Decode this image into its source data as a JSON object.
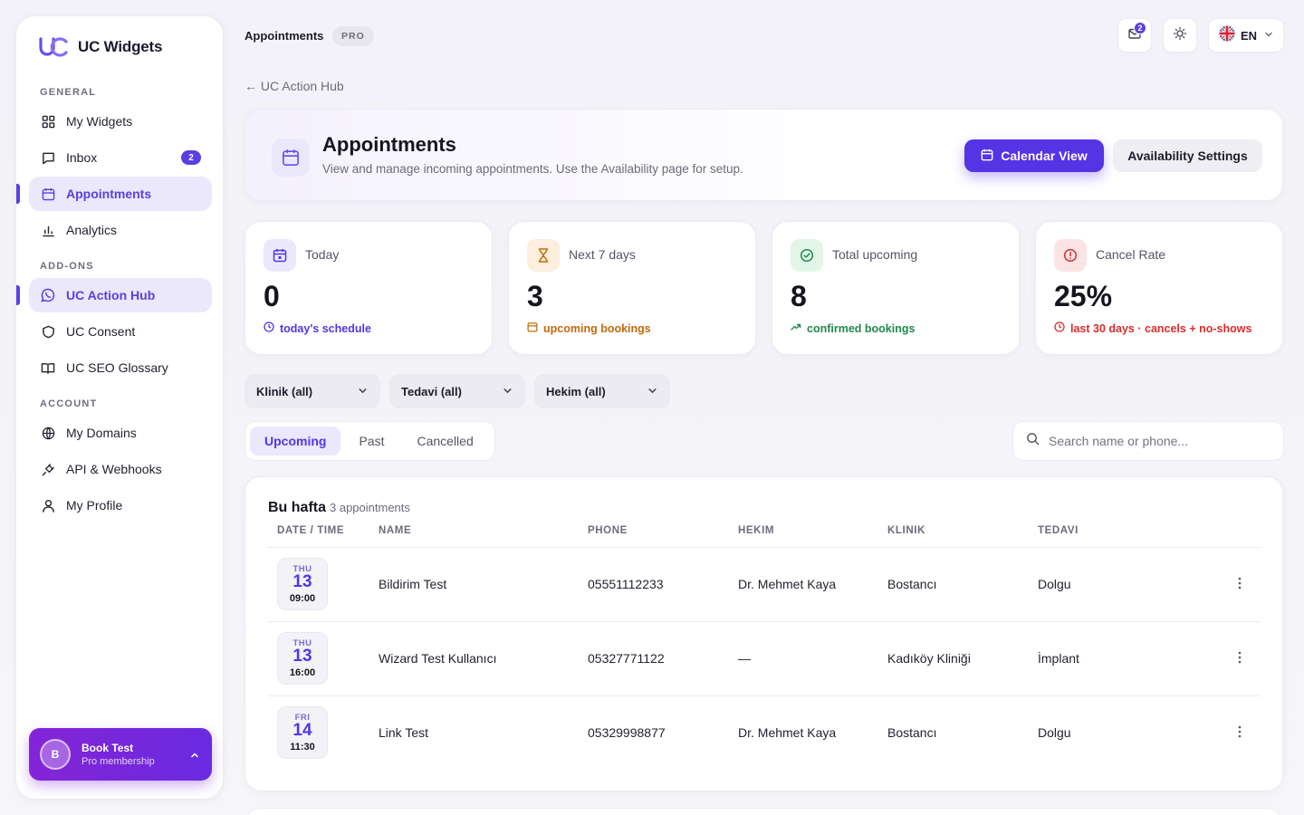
{
  "brand": {
    "name": "UC Widgets",
    "accent": "#5534e6"
  },
  "sidebar": {
    "sections": [
      {
        "title": "GENERAL"
      },
      {
        "title": "ADD-ONS"
      },
      {
        "title": "ACCOUNT"
      }
    ],
    "items": [
      {
        "label": "My Widgets",
        "icon": "grid-icon"
      },
      {
        "label": "Inbox",
        "icon": "inbox-icon",
        "badge": "2"
      },
      {
        "label": "Appointments",
        "icon": "calendar-icon",
        "active": true
      },
      {
        "label": "Analytics",
        "icon": "bar-chart-icon"
      },
      {
        "label": "UC Action Hub",
        "icon": "whatsapp-icon",
        "active": true
      },
      {
        "label": "UC Consent",
        "icon": "shield-icon"
      },
      {
        "label": "UC SEO Glossary",
        "icon": "book-icon"
      },
      {
        "label": "My Domains",
        "icon": "globe-icon"
      },
      {
        "label": "API & Webhooks",
        "icon": "plug-icon"
      },
      {
        "label": "My Profile",
        "icon": "user-icon"
      }
    ],
    "user": {
      "initial": "B",
      "name": "Book Test",
      "plan": "Pro membership"
    }
  },
  "topbar": {
    "title": "Appointments",
    "badge": "PRO",
    "notifications": "2",
    "language": "EN"
  },
  "back_link": "← UC Action Hub",
  "header": {
    "title": "Appointments",
    "subtitle": "View and manage incoming appointments. Use the Availability page for setup.",
    "primary_button": "Calendar View",
    "secondary_button": "Availability Settings"
  },
  "stats": [
    {
      "label": "Today",
      "value": "0",
      "foot": "today's schedule",
      "color": "#5534e6"
    },
    {
      "label": "Next 7 days",
      "value": "3",
      "foot": "upcoming bookings",
      "color": "#c26a0a"
    },
    {
      "label": "Total upcoming",
      "value": "8",
      "foot": "confirmed bookings",
      "color": "#1e8a4a"
    },
    {
      "label": "Cancel Rate",
      "value": "25%",
      "foot": "last 30 days · cancels + no-shows",
      "color": "#dc2c2c"
    }
  ],
  "filters": [
    {
      "value": "Klinik (all)"
    },
    {
      "value": "Tedavi (all)"
    },
    {
      "value": "Hekim (all)"
    }
  ],
  "tabs": [
    {
      "label": "Upcoming",
      "active": true
    },
    {
      "label": "Past"
    },
    {
      "label": "Cancelled"
    }
  ],
  "search": {
    "placeholder": "Search name or phone...",
    "value": ""
  },
  "table": {
    "group_title": "Bu hafta",
    "group_count": "3 appointments",
    "columns": [
      "DATE / TIME",
      "NAME",
      "PHONE",
      "HEKIM",
      "KLINIK",
      "TEDAVI"
    ],
    "rows": [
      {
        "dow": "THU",
        "day": "13",
        "time": "09:00",
        "name": "Bildirim Test",
        "phone": "05551112233",
        "hekim": "Dr. Mehmet Kaya",
        "klinik": "Bostancı",
        "tedavi": "Dolgu"
      },
      {
        "dow": "THU",
        "day": "13",
        "time": "16:00",
        "name": "Wizard Test Kullanıcı",
        "phone": "05327771122",
        "hekim": "—",
        "klinik": "Kadıköy Kliniği",
        "tedavi": "İmplant"
      },
      {
        "dow": "FRI",
        "day": "14",
        "time": "11:30",
        "name": "Link Test",
        "phone": "05329998877",
        "hekim": "Dr. Mehmet Kaya",
        "klinik": "Bostancı",
        "tedavi": "Dolgu"
      }
    ]
  }
}
